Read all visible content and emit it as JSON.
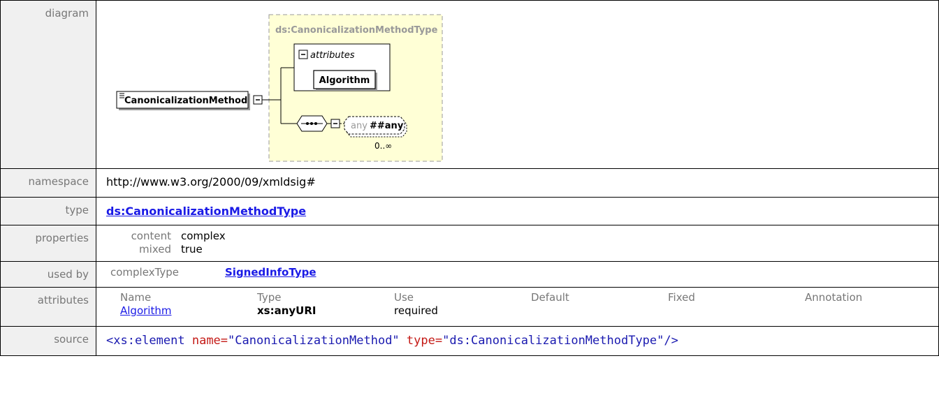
{
  "rows": {
    "diagram": {
      "label": "diagram",
      "type_box_title": "ds:CanonicalizationMethodType",
      "attributes_group": "attributes",
      "attribute_name": "Algorithm",
      "element_name": "CanonicalizationMethod",
      "any_prefix": "any",
      "any_ns": "##any",
      "any_occurrence": "0..∞",
      "colors": {
        "type_box_fill": "#ffffd6",
        "type_box_border": "#999999"
      }
    },
    "namespace": {
      "label": "namespace",
      "value": "http://www.w3.org/2000/09/xmldsig#"
    },
    "type": {
      "label": "type",
      "value": "ds:CanonicalizationMethodType"
    },
    "properties": {
      "label": "properties",
      "items": [
        {
          "key": "content",
          "value": "complex"
        },
        {
          "key": "mixed",
          "value": "true"
        }
      ]
    },
    "used_by": {
      "label": "used by",
      "kind": "complexType",
      "value": "SignedInfoType"
    },
    "attributes": {
      "label": "attributes",
      "headers": [
        "Name",
        "Type",
        "Use",
        "Default",
        "Fixed",
        "Annotation"
      ],
      "row": {
        "name": "Algorithm",
        "type": "xs:anyURI",
        "use": "required",
        "default": "",
        "fixed": "",
        "annotation": ""
      }
    },
    "source": {
      "label": "source",
      "open": "<xs:element",
      "attr1_name": "name=",
      "attr1_value": "\"CanonicalizationMethod\"",
      "attr2_name": "type=",
      "attr2_value": "\"ds:CanonicalizationMethodType\"",
      "close": "/>"
    }
  }
}
